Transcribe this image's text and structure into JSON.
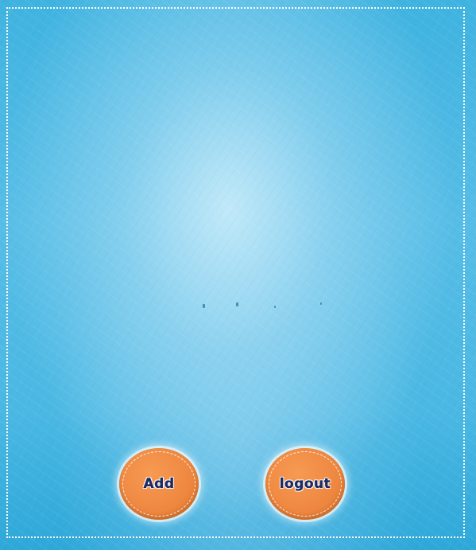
{
  "background": {
    "base_color": "#4ab8e3",
    "highlight_color": "#d2f0fc",
    "frame_color": "#ffffff"
  },
  "buttons": {
    "add_label": "Add",
    "logout_label": "logout",
    "color": "#ee8740",
    "text_color": "#1c2a66"
  }
}
